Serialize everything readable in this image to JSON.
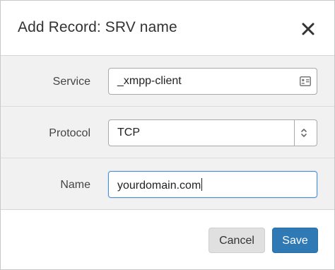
{
  "dialog": {
    "title": "Add Record: SRV name",
    "close_icon": "close-icon"
  },
  "form": {
    "service": {
      "label": "Service",
      "value": "_xmpp-client",
      "icon": "contact-card-icon"
    },
    "protocol": {
      "label": "Protocol",
      "value": "TCP",
      "icon": "up-down-chevron-icon"
    },
    "name": {
      "label": "Name",
      "value": "yourdomain.com"
    }
  },
  "footer": {
    "cancel_label": "Cancel",
    "save_label": "Save"
  },
  "colors": {
    "primary": "#2f79b5",
    "focus_border": "#4a90d9",
    "body_bg": "#f1f1f1"
  }
}
